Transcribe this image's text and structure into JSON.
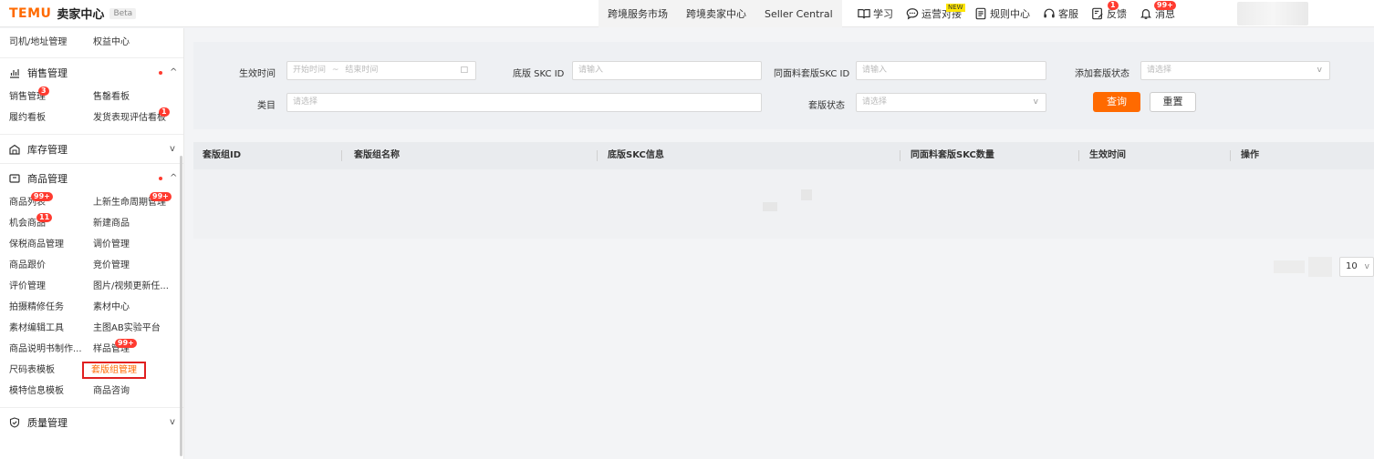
{
  "header": {
    "brand": "TEMU",
    "sub": "卖家中心",
    "beta": "Beta",
    "nav": [
      "跨境服务市场",
      "跨境卖家中心",
      "Seller Central"
    ],
    "icons": [
      {
        "label": "学习",
        "icon": "book-icon"
      },
      {
        "label": "运营对接",
        "icon": "chat-icon",
        "tag": "NEW"
      },
      {
        "label": "规则中心",
        "icon": "document-icon"
      },
      {
        "label": "客服",
        "icon": "headset-icon"
      },
      {
        "label": "反馈",
        "icon": "feedback-icon",
        "badge": "1"
      },
      {
        "label": "消息",
        "icon": "bell-icon",
        "badge": "99+"
      }
    ]
  },
  "sidebar": {
    "top_row": [
      "司机/地址管理",
      "权益中心"
    ],
    "sales": {
      "title": "销售管理",
      "items": [
        {
          "label": "销售管理",
          "badge": "3"
        },
        {
          "label": "售罄看板"
        },
        {
          "label": "履约看板"
        },
        {
          "label": "发货表现评估看板",
          "badge": "1"
        }
      ]
    },
    "inventory": {
      "title": "库存管理"
    },
    "goods": {
      "title": "商品管理",
      "items": [
        {
          "label": "商品列表",
          "badge": "99+"
        },
        {
          "label": "上新生命周期管理",
          "badge": "99+"
        },
        {
          "label": "机会商品",
          "badge": "11"
        },
        {
          "label": "新建商品"
        },
        {
          "label": "保税商品管理"
        },
        {
          "label": "调价管理"
        },
        {
          "label": "商品跟价"
        },
        {
          "label": "竞价管理"
        },
        {
          "label": "评价管理"
        },
        {
          "label": "图片/视频更新任..."
        },
        {
          "label": "拍摄精修任务"
        },
        {
          "label": "素材中心"
        },
        {
          "label": "素材编辑工具"
        },
        {
          "label": "主图AB实验平台"
        },
        {
          "label": "商品说明书制作..."
        },
        {
          "label": "样品管理",
          "badge": "99+"
        },
        {
          "label": "尺码表模板"
        },
        {
          "label": "套版组管理",
          "active": true
        },
        {
          "label": "模特信息模板"
        },
        {
          "label": "商品咨询"
        }
      ]
    },
    "quality": {
      "title": "质量管理"
    }
  },
  "filters": {
    "effective_time_label": "生效时间",
    "start_placeholder": "开始时间",
    "end_placeholder": "结束时间",
    "range_sep": "~",
    "base_skc_label": "底版 SKC ID",
    "base_skc_placeholder": "请输入",
    "same_skc_label": "同面料套版SKC ID",
    "same_skc_placeholder": "请输入",
    "add_status_label": "添加套版状态",
    "add_status_placeholder": "请选择",
    "category_label": "类目",
    "category_placeholder": "请选择",
    "status_label": "套版状态",
    "status_placeholder": "请选择",
    "query_button": "查询",
    "reset_button": "重置"
  },
  "table": {
    "columns": [
      "套版组ID",
      "套版组名称",
      "底版SKC信息",
      "同面料套版SKC数量",
      "生效时间",
      "操作"
    ]
  },
  "pagination": {
    "page_size": "10"
  },
  "colors": {
    "accent": "#ff6a00",
    "badge": "#ff3b30"
  }
}
